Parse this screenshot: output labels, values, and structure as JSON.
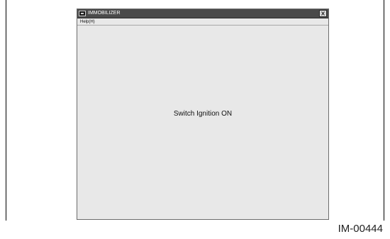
{
  "window": {
    "title": "IMMOBILIZER",
    "menu": {
      "help_label": "Help(H)"
    },
    "message": "Switch Ignition ON"
  },
  "figure": {
    "id": "IM-00444"
  },
  "icons": {
    "app": "window-app-icon",
    "close": "close-icon"
  },
  "colors": {
    "title_bar": "#4a4a4a",
    "client_background": "#e8e8e8",
    "frame_line": "#000000"
  }
}
